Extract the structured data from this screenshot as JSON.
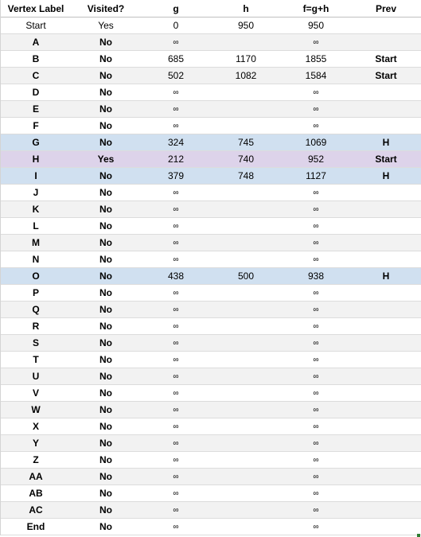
{
  "table": {
    "headers": [
      "Vertex Label",
      "Visited?",
      "g",
      "h",
      "f=g+h",
      "Prev"
    ],
    "rows": [
      {
        "label": "Start",
        "visited": "Yes",
        "g": "0",
        "h": "950",
        "f": "950",
        "prev": "",
        "style": "plain"
      },
      {
        "label": "A",
        "visited": "No",
        "g": "∞",
        "h": "",
        "f": "∞",
        "prev": "",
        "style": "zebra"
      },
      {
        "label": "B",
        "visited": "No",
        "g": "685",
        "h": "1170",
        "f": "1855",
        "prev": "Start",
        "style": ""
      },
      {
        "label": "C",
        "visited": "No",
        "g": "502",
        "h": "1082",
        "f": "1584",
        "prev": "Start",
        "style": "zebra"
      },
      {
        "label": "D",
        "visited": "No",
        "g": "∞",
        "h": "",
        "f": "∞",
        "prev": "",
        "style": ""
      },
      {
        "label": "E",
        "visited": "No",
        "g": "∞",
        "h": "",
        "f": "∞",
        "prev": "",
        "style": "zebra"
      },
      {
        "label": "F",
        "visited": "No",
        "g": "∞",
        "h": "",
        "f": "∞",
        "prev": "",
        "style": ""
      },
      {
        "label": "G",
        "visited": "No",
        "g": "324",
        "h": "745",
        "f": "1069",
        "prev": "H",
        "style": "hl-blue"
      },
      {
        "label": "H",
        "visited": "Yes",
        "g": "212",
        "h": "740",
        "f": "952",
        "prev": "Start",
        "style": "hl-purple"
      },
      {
        "label": "I",
        "visited": "No",
        "g": "379",
        "h": "748",
        "f": "1127",
        "prev": "H",
        "style": "hl-blue"
      },
      {
        "label": "J",
        "visited": "No",
        "g": "∞",
        "h": "",
        "f": "∞",
        "prev": "",
        "style": ""
      },
      {
        "label": "K",
        "visited": "No",
        "g": "∞",
        "h": "",
        "f": "∞",
        "prev": "",
        "style": "zebra"
      },
      {
        "label": "L",
        "visited": "No",
        "g": "∞",
        "h": "",
        "f": "∞",
        "prev": "",
        "style": ""
      },
      {
        "label": "M",
        "visited": "No",
        "g": "∞",
        "h": "",
        "f": "∞",
        "prev": "",
        "style": "zebra"
      },
      {
        "label": "N",
        "visited": "No",
        "g": "∞",
        "h": "",
        "f": "∞",
        "prev": "",
        "style": ""
      },
      {
        "label": "O",
        "visited": "No",
        "g": "438",
        "h": "500",
        "f": "938",
        "prev": "H",
        "style": "hl-blue"
      },
      {
        "label": "P",
        "visited": "No",
        "g": "∞",
        "h": "",
        "f": "∞",
        "prev": "",
        "style": ""
      },
      {
        "label": "Q",
        "visited": "No",
        "g": "∞",
        "h": "",
        "f": "∞",
        "prev": "",
        "style": "zebra"
      },
      {
        "label": "R",
        "visited": "No",
        "g": "∞",
        "h": "",
        "f": "∞",
        "prev": "",
        "style": ""
      },
      {
        "label": "S",
        "visited": "No",
        "g": "∞",
        "h": "",
        "f": "∞",
        "prev": "",
        "style": "zebra"
      },
      {
        "label": "T",
        "visited": "No",
        "g": "∞",
        "h": "",
        "f": "∞",
        "prev": "",
        "style": ""
      },
      {
        "label": "U",
        "visited": "No",
        "g": "∞",
        "h": "",
        "f": "∞",
        "prev": "",
        "style": "zebra"
      },
      {
        "label": "V",
        "visited": "No",
        "g": "∞",
        "h": "",
        "f": "∞",
        "prev": "",
        "style": ""
      },
      {
        "label": "W",
        "visited": "No",
        "g": "∞",
        "h": "",
        "f": "∞",
        "prev": "",
        "style": "zebra"
      },
      {
        "label": "X",
        "visited": "No",
        "g": "∞",
        "h": "",
        "f": "∞",
        "prev": "",
        "style": ""
      },
      {
        "label": "Y",
        "visited": "No",
        "g": "∞",
        "h": "",
        "f": "∞",
        "prev": "",
        "style": "zebra"
      },
      {
        "label": "Z",
        "visited": "No",
        "g": "∞",
        "h": "",
        "f": "∞",
        "prev": "",
        "style": ""
      },
      {
        "label": "AA",
        "visited": "No",
        "g": "∞",
        "h": "",
        "f": "∞",
        "prev": "",
        "style": "zebra"
      },
      {
        "label": "AB",
        "visited": "No",
        "g": "∞",
        "h": "",
        "f": "∞",
        "prev": "",
        "style": ""
      },
      {
        "label": "AC",
        "visited": "No",
        "g": "∞",
        "h": "",
        "f": "∞",
        "prev": "",
        "style": "zebra"
      },
      {
        "label": "End",
        "visited": "No",
        "g": "∞",
        "h": "",
        "f": "∞",
        "prev": "",
        "style": ""
      }
    ]
  },
  "colors": {
    "highlight_blue": "#d0e0f0",
    "highlight_purple": "#ddd3ea",
    "zebra": "#f2f2f2"
  }
}
